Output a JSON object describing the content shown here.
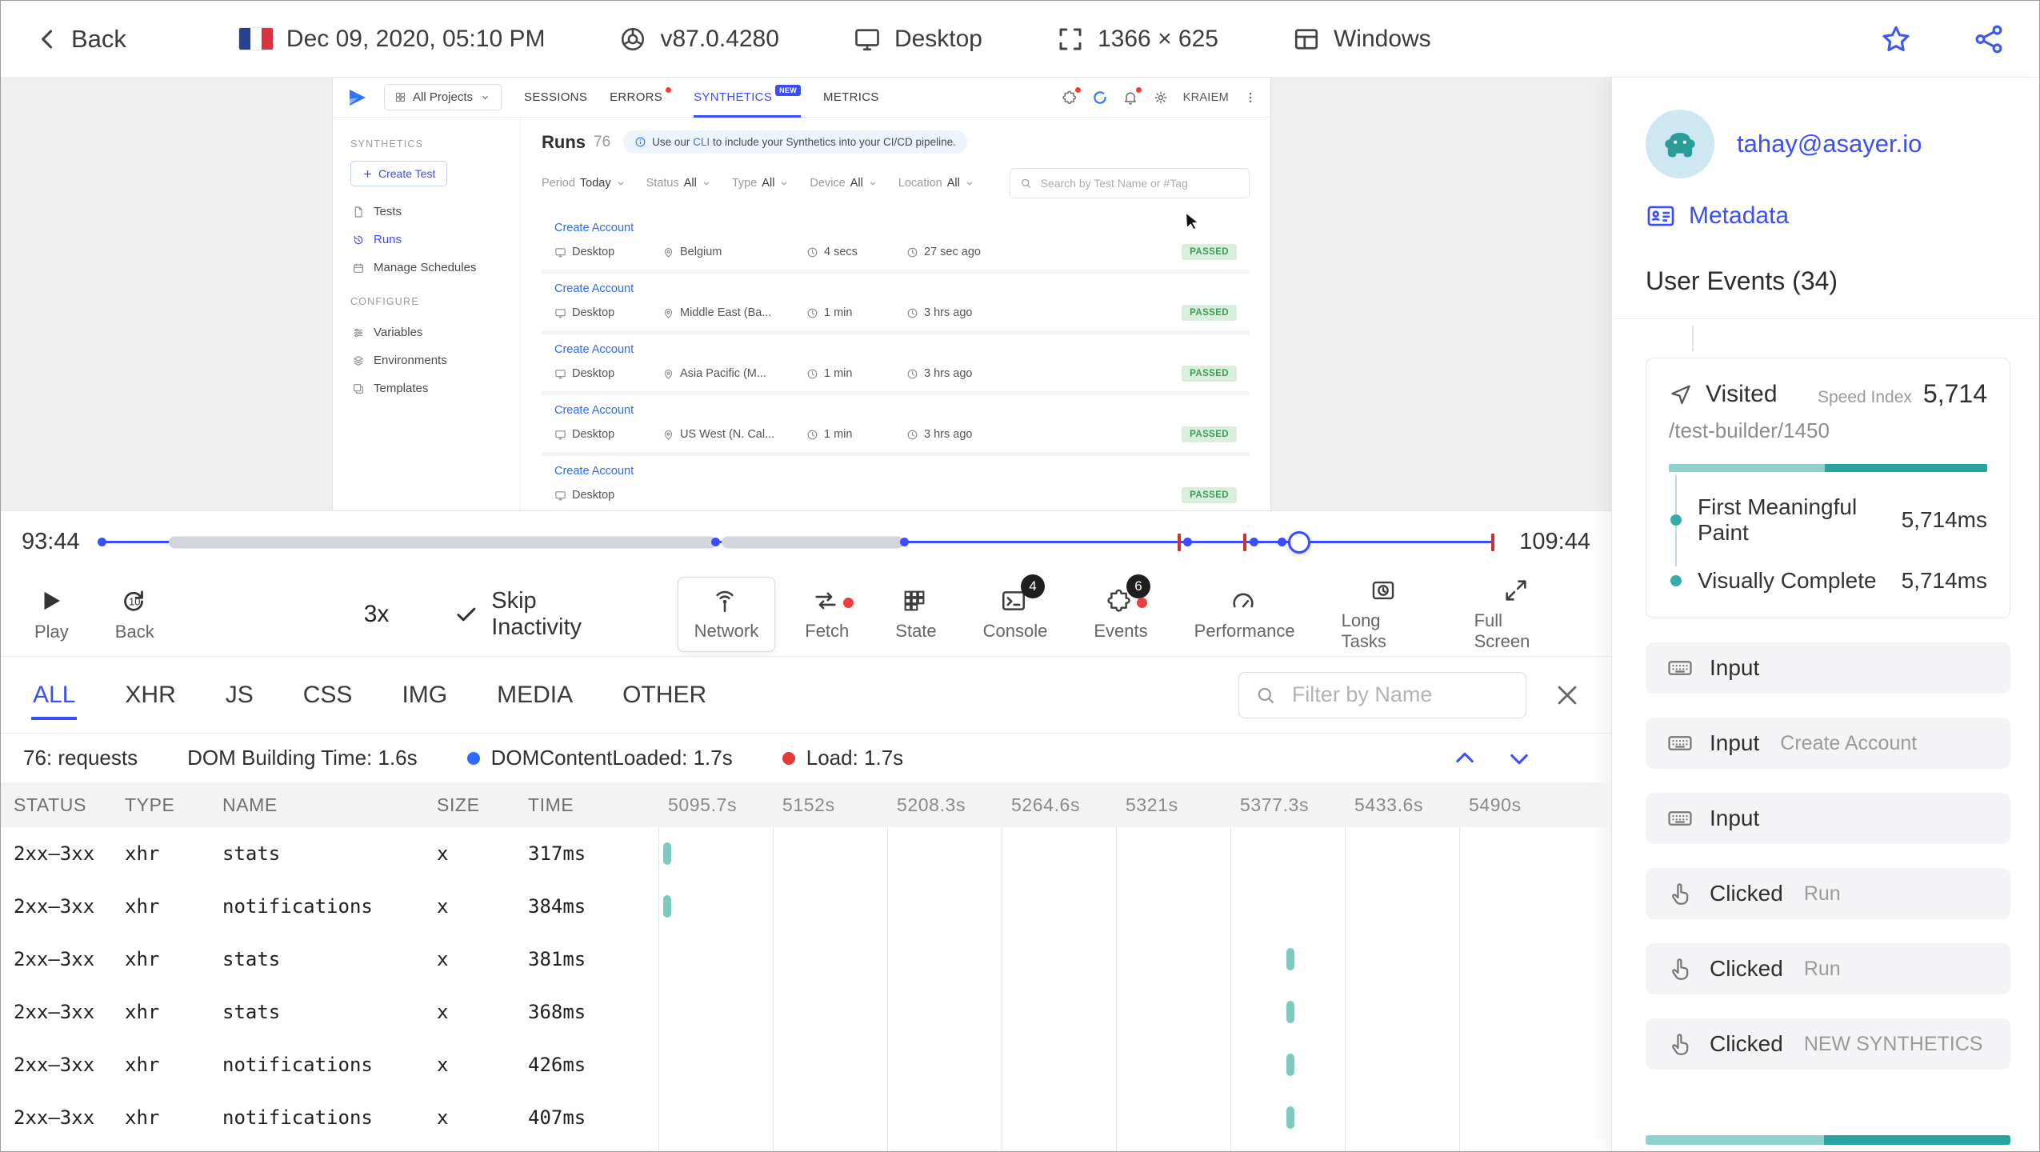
{
  "colors": {
    "accent": "#394eff",
    "teal": "#35aca8",
    "teal_dark": "#27a4a0",
    "teal_light": "#8ed1cd",
    "red": "#e03a3a",
    "green": "#3d9c56",
    "green_bg": "#d9efdc"
  },
  "topbar": {
    "back": "Back",
    "date": "Dec 09, 2020, 05:10 PM",
    "browser": "v87.0.4280",
    "device": "Desktop",
    "resolution": "1366 × 625",
    "os": "Windows",
    "star_icon": "star-icon",
    "share_icon": "share-icon",
    "flag_icon": "france-flag-icon"
  },
  "replay": {
    "nav": {
      "project": "All Projects",
      "tabs": [
        {
          "label": "SESSIONS"
        },
        {
          "label": "ERRORS",
          "dot": true
        },
        {
          "label": "SYNTHETICS",
          "active": true,
          "badge": "NEW"
        },
        {
          "label": "METRICS"
        }
      ],
      "icons": [
        {
          "icon": "puzzle-icon",
          "dot": true
        },
        {
          "icon": "spinner-icon"
        },
        {
          "icon": "bell-icon",
          "dot": true
        },
        {
          "icon": "gear-icon"
        }
      ],
      "user": "KRAIEM"
    },
    "side": {
      "section": "SYNTHETICS",
      "create": "Create Test",
      "items": [
        {
          "label": "Tests",
          "icon": "file-icon"
        },
        {
          "label": "Runs",
          "icon": "runs-icon",
          "active": true
        },
        {
          "label": "Manage Schedules",
          "icon": "calendar-icon"
        }
      ],
      "section2": "CONFIGURE",
      "items2": [
        {
          "label": "Variables",
          "icon": "sliders-icon"
        },
        {
          "label": "Environments",
          "icon": "layers-icon"
        },
        {
          "label": "Templates",
          "icon": "copy-icon"
        }
      ]
    },
    "content": {
      "title": "Runs",
      "count": "76",
      "banner_prefix": "Use our ",
      "banner_link": "CLI",
      "banner_suffix": " to include your Synthetics into your CI/CD pipeline.",
      "filters": [
        {
          "label": "Period",
          "value": "Today"
        },
        {
          "label": "Status",
          "value": "All"
        },
        {
          "label": "Type",
          "value": "All"
        },
        {
          "label": "Device",
          "value": "All"
        },
        {
          "label": "Location",
          "value": "All"
        }
      ],
      "search_placeholder": "Search by Test Name or #Tag",
      "runs": [
        {
          "name": "Create Account",
          "device": "Desktop",
          "location": "Belgium",
          "duration": "4 secs",
          "ago": "27 sec ago",
          "status": "PASSED"
        },
        {
          "name": "Create Account",
          "device": "Desktop",
          "location": "Middle East (Ba...",
          "duration": "1 min",
          "ago": "3 hrs ago",
          "status": "PASSED"
        },
        {
          "name": "Create Account",
          "device": "Desktop",
          "location": "Asia Pacific (M...",
          "duration": "1 min",
          "ago": "3 hrs ago",
          "status": "PASSED"
        },
        {
          "name": "Create Account",
          "device": "Desktop",
          "location": "US West (N. Cal...",
          "duration": "1 min",
          "ago": "3 hrs ago",
          "status": "PASSED"
        },
        {
          "name": "Create Account",
          "device": "Desktop",
          "location": "",
          "duration": "",
          "ago": "",
          "status": "PASSED"
        }
      ]
    }
  },
  "player": {
    "time_start": "93:44",
    "time_end": "109:44",
    "play_label": "Play",
    "back_label": "Back",
    "back_badge": "10",
    "speed": "3x",
    "skip_label": "Skip Inactivity",
    "markers": {
      "capsules": [
        [
          4.8,
          39.2
        ],
        [
          44.4,
          13.1
        ]
      ],
      "dots": [
        0,
        44,
        57.5,
        77.8,
        82.6,
        84.6
      ],
      "reds": [
        77.2,
        81.9,
        99.7
      ],
      "handle": 85.8
    },
    "tools": [
      {
        "label": "Network",
        "icon": "network-icon",
        "active": true
      },
      {
        "label": "Fetch",
        "icon": "fetch-icon",
        "dot": true
      },
      {
        "label": "State",
        "icon": "state-icon"
      },
      {
        "label": "Console",
        "icon": "console-icon",
        "badge": "4"
      },
      {
        "label": "Events",
        "icon": "events-icon",
        "badge": "6",
        "dot": true
      },
      {
        "label": "Performance",
        "icon": "performance-icon"
      },
      {
        "label": "Long Tasks",
        "icon": "longtasks-icon"
      },
      {
        "label": "Full Screen",
        "icon": "fullscreen-icon"
      }
    ]
  },
  "network": {
    "tabs": [
      "ALL",
      "XHR",
      "JS",
      "CSS",
      "IMG",
      "MEDIA",
      "OTHER"
    ],
    "active_tab": "ALL",
    "filter_placeholder": "Filter by Name",
    "summary": {
      "requests": "76: requests",
      "dom": "DOM Building Time: 1.6s",
      "dcl": "DOMContentLoaded: 1.7s",
      "load": "Load: 1.7s"
    },
    "columns": [
      "STATUS",
      "TYPE",
      "NAME",
      "SIZE",
      "TIME"
    ],
    "time_ticks": [
      "5095.7s",
      "5152s",
      "5208.3s",
      "5264.6s",
      "5321s",
      "5377.3s",
      "5433.6s",
      "5490s"
    ],
    "rows": [
      {
        "status": "2xx–3xx",
        "type": "xhr",
        "name": "stats",
        "size": "x",
        "time": "317ms",
        "tick_pct": 0.5
      },
      {
        "status": "2xx–3xx",
        "type": "xhr",
        "name": "notifications",
        "size": "x",
        "time": "384ms",
        "tick_pct": 0.5
      },
      {
        "status": "2xx–3xx",
        "type": "xhr",
        "name": "stats",
        "size": "x",
        "time": "381ms",
        "tick_pct": 65.9
      },
      {
        "status": "2xx–3xx",
        "type": "xhr",
        "name": "stats",
        "size": "x",
        "time": "368ms",
        "tick_pct": 65.9
      },
      {
        "status": "2xx–3xx",
        "type": "xhr",
        "name": "notifications",
        "size": "x",
        "time": "426ms",
        "tick_pct": 65.9
      },
      {
        "status": "2xx–3xx",
        "type": "xhr",
        "name": "notifications",
        "size": "x",
        "time": "407ms",
        "tick_pct": 65.9
      }
    ]
  },
  "user_panel": {
    "email": "tahay@asayer.io",
    "metadata": "Metadata",
    "events_title": "User Events (34)",
    "visited": {
      "label": "Visited",
      "speed_index_label": "Speed Index",
      "speed_index": "5,714",
      "path": "/test-builder/1450",
      "bar_light_pct": 49,
      "metrics": [
        {
          "label": "First Meaningful Paint",
          "value": "5,714ms"
        },
        {
          "label": "Visually Complete",
          "value": "5,714ms"
        }
      ]
    },
    "events": [
      {
        "icon": "keyboard-icon",
        "label": "Input",
        "value": ""
      },
      {
        "icon": "keyboard-icon",
        "label": "Input",
        "value": "Create Account"
      },
      {
        "icon": "keyboard-icon",
        "label": "Input",
        "value": ""
      },
      {
        "icon": "hand-icon",
        "label": "Clicked",
        "value": "Run"
      },
      {
        "icon": "hand-icon",
        "label": "Clicked",
        "value": "Run"
      },
      {
        "icon": "hand-icon",
        "label": "Clicked",
        "value": "NEW SYNTHETICS"
      }
    ]
  }
}
